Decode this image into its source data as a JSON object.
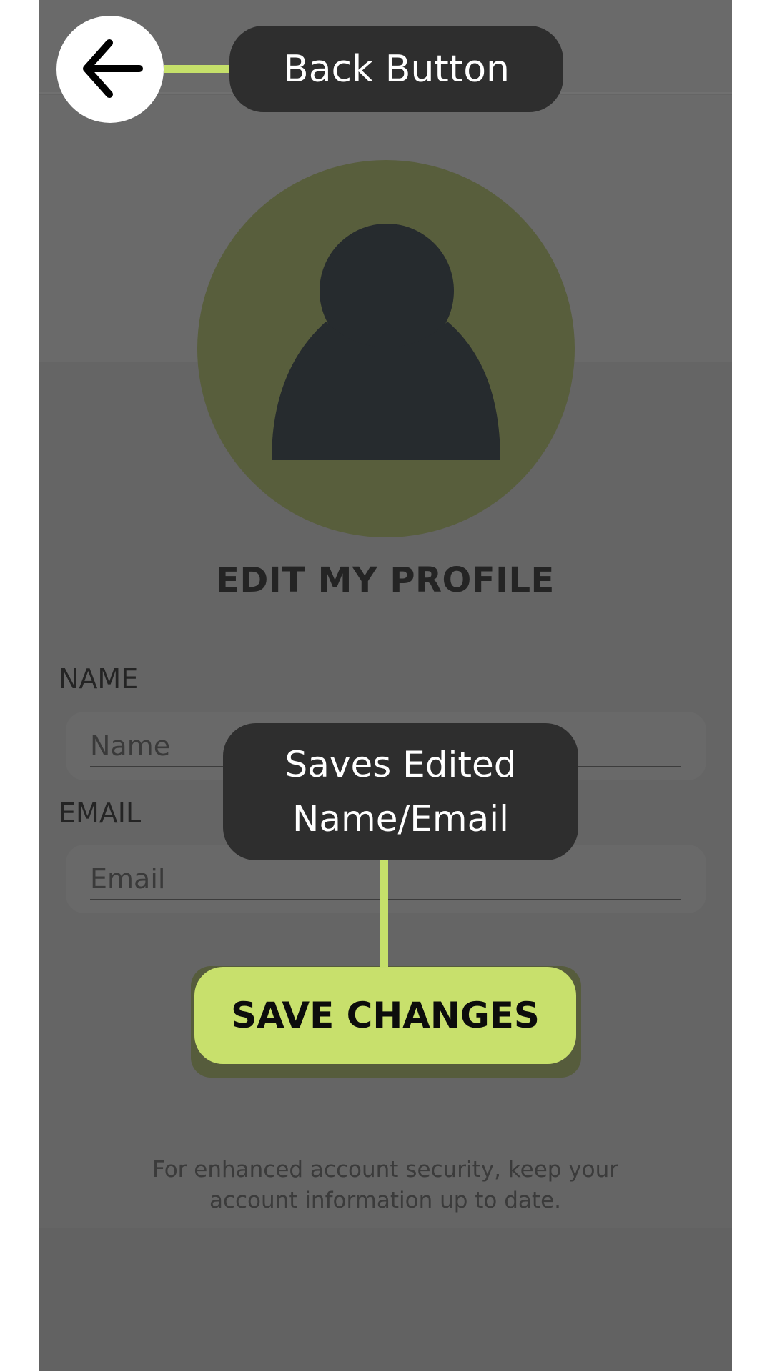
{
  "screen": {
    "title": "EDIT MY PROFILE",
    "name_field": {
      "label": "NAME",
      "placeholder": "Name",
      "value": ""
    },
    "email_field": {
      "label": "EMAIL",
      "placeholder": "Email",
      "value": ""
    },
    "save_button_label": "SAVE CHANGES",
    "footer_note": "For enhanced account security, keep your account information up to date.",
    "avatar_icon": "user-silhouette-icon"
  },
  "annotations": {
    "back": {
      "icon": "arrow-left-icon",
      "callout": "Back Button"
    },
    "save": {
      "callout_line1": "Saves Edited",
      "callout_line2": "Name/Email"
    }
  },
  "colors": {
    "accent": "#c8e06c",
    "overlay": "#656565",
    "callout_bg": "#2e2e2e",
    "avatar_bg": "#585e3c"
  }
}
